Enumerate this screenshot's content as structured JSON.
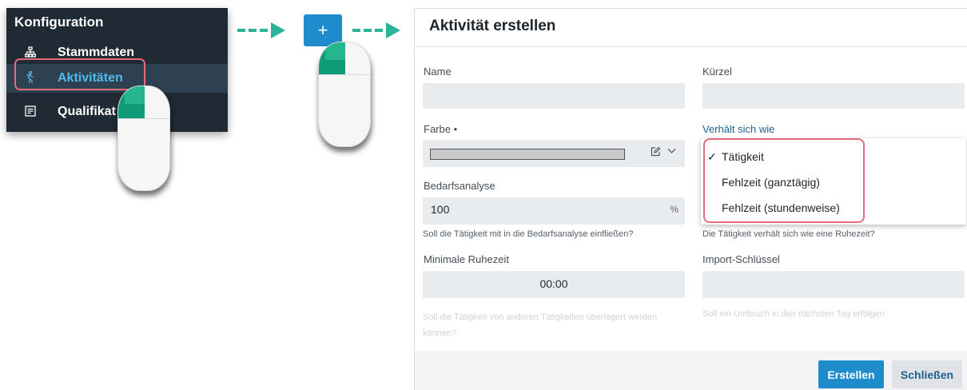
{
  "sidebar": {
    "title": "Konfiguration",
    "items": [
      {
        "label": "Stammdaten",
        "icon": "sitemap-icon"
      },
      {
        "label": "Aktivitäten",
        "icon": "hiking-icon",
        "active": true
      },
      {
        "label": "Qualifikat",
        "icon": "certificate-list-icon"
      }
    ]
  },
  "plus_button": {
    "label": "+"
  },
  "dialog": {
    "title": "Aktivität erstellen",
    "name": {
      "label": "Name",
      "value": ""
    },
    "kuerzel": {
      "label": "Kürzel",
      "value": ""
    },
    "farbe": {
      "label": "Farbe •",
      "color": "#c9c9c9"
    },
    "verhaelt": {
      "label": "Verhält sich wie",
      "options": [
        "Tätigkeit",
        "Fehlzeit (ganztägig)",
        "Fehlzeit (stundenweise)"
      ],
      "selected": "Tätigkeit",
      "hint": "Die Tätigkeit verhält sich wie eine Ruhezeit?"
    },
    "bedarf": {
      "label": "Bedarfsanalyse",
      "value": "100",
      "unit": "%",
      "hint": "Soll die Tätigkeit mit in die Bedarfsanalyse einfließen?"
    },
    "ruhezeit": {
      "label": "Minimale Ruhezeit",
      "value": "00:00",
      "hint": "Soll die Tätigkeit von anderen Tätigkeiten überlagert werden können?"
    },
    "import": {
      "label": "Import-Schlüssel",
      "value": "",
      "hint": "Soll ein Umbruch in den nächsten Tag erfolgen"
    },
    "buttons": {
      "create": "Erstellen",
      "close": "Schließen"
    }
  },
  "colors": {
    "accent": "#1e8ccc",
    "sidebar_bg": "#1f2a35",
    "highlight": "#e46c7a",
    "arrow": "#2bb39a"
  }
}
